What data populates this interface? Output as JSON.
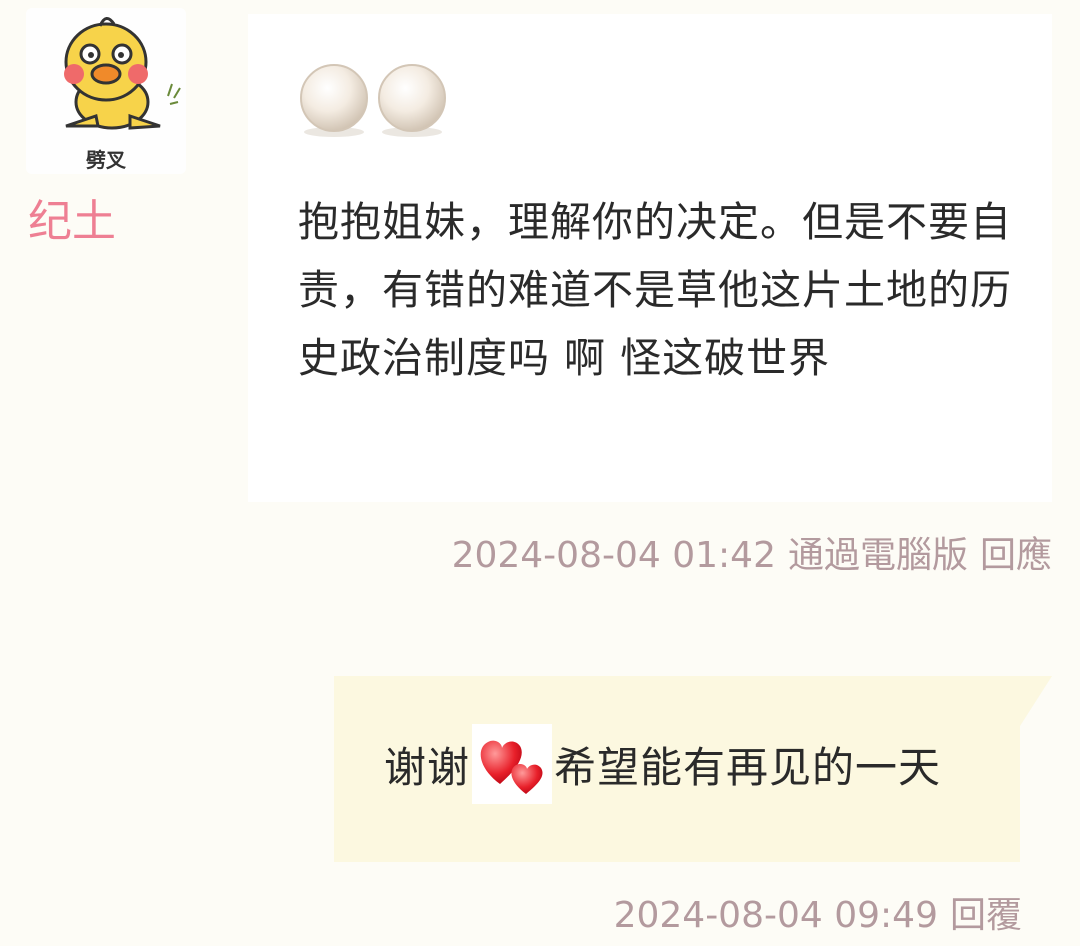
{
  "incoming": {
    "avatar_caption": "劈叉",
    "avatar_icon": "yellow-duck-sticker-icon",
    "username": "纪土",
    "sticker_icon": "two-pearls-icon",
    "text": "抱抱姐妹，理解你的决定。但是不要自责，有错的难道不是草他这片土地的历史政治制度吗 啊 怪这破世界",
    "timestamp": "2024-08-04 01:42",
    "via": "通過電腦版",
    "action": "回應"
  },
  "outgoing": {
    "text_before": "谢谢",
    "emoji_icon": "double-heart-icon",
    "text_after": "希望能有再见的一天",
    "timestamp": "2024-08-04 09:49",
    "action": "回覆"
  },
  "colors": {
    "page_bg": "#fdfcf6",
    "username": "#ee7f93",
    "meta_text": "#b39a9e",
    "outgoing_bubble": "#fcf8e0"
  }
}
